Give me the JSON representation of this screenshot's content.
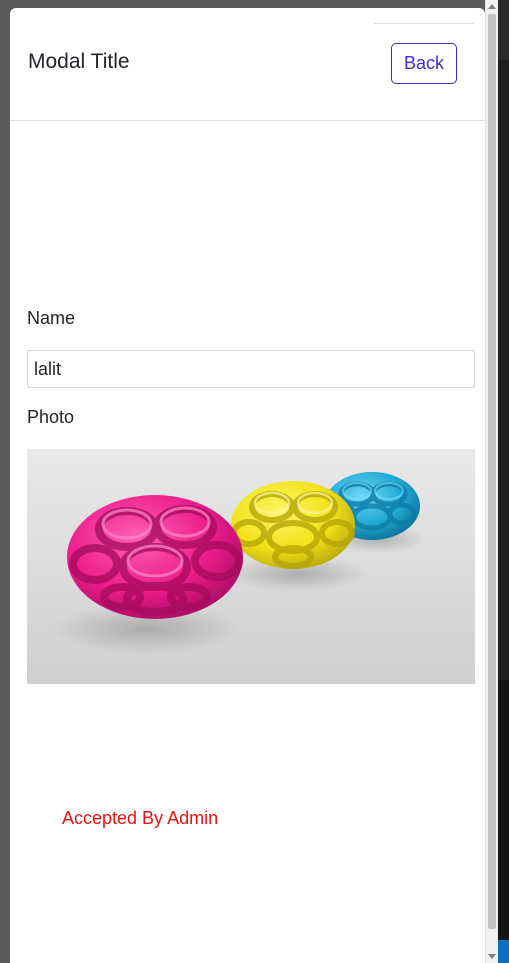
{
  "modal": {
    "title": "Modal Title",
    "back_label": "Back"
  },
  "form": {
    "name_label": "Name",
    "name_value": "lalit",
    "photo_label": "Photo",
    "photo_icon": "knot-balls-photo"
  },
  "status": {
    "text": "Accepted By Admin",
    "color": "#ee1111"
  },
  "colors": {
    "accent": "#3b2fd6",
    "ball_magenta": "#ec1c8c",
    "ball_yellow": "#f2e21a",
    "ball_cyan": "#20a9d6"
  }
}
